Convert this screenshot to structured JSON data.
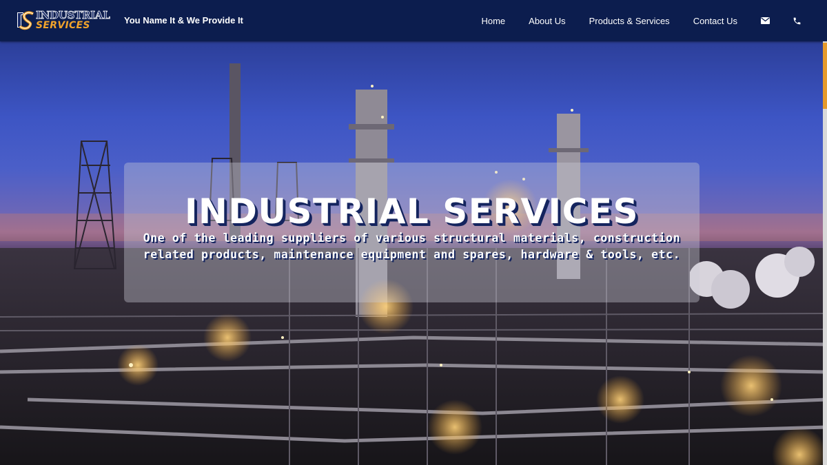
{
  "brand": {
    "logo_top": "INDUSTRIAL",
    "logo_bottom": "SERVICES",
    "tagline": "You Name It & We Provide It"
  },
  "nav": {
    "items": [
      {
        "label": "Home"
      },
      {
        "label": "About Us"
      },
      {
        "label": "Products & Services"
      },
      {
        "label": "Contact Us"
      }
    ],
    "icons": [
      "mail-icon",
      "phone-icon"
    ]
  },
  "hero": {
    "title": "INDUSTRIAL SERVICES",
    "subtitle": "One of the leading suppliers of various structural materials, construction related products, maintenance equipment and spares, hardware & tools, etc."
  },
  "colors": {
    "navbar": "#0c1d4e",
    "logo_accent": "#f1a32b",
    "text_shadow": "#14245e",
    "scroll_thumb": "#e59a2c"
  }
}
